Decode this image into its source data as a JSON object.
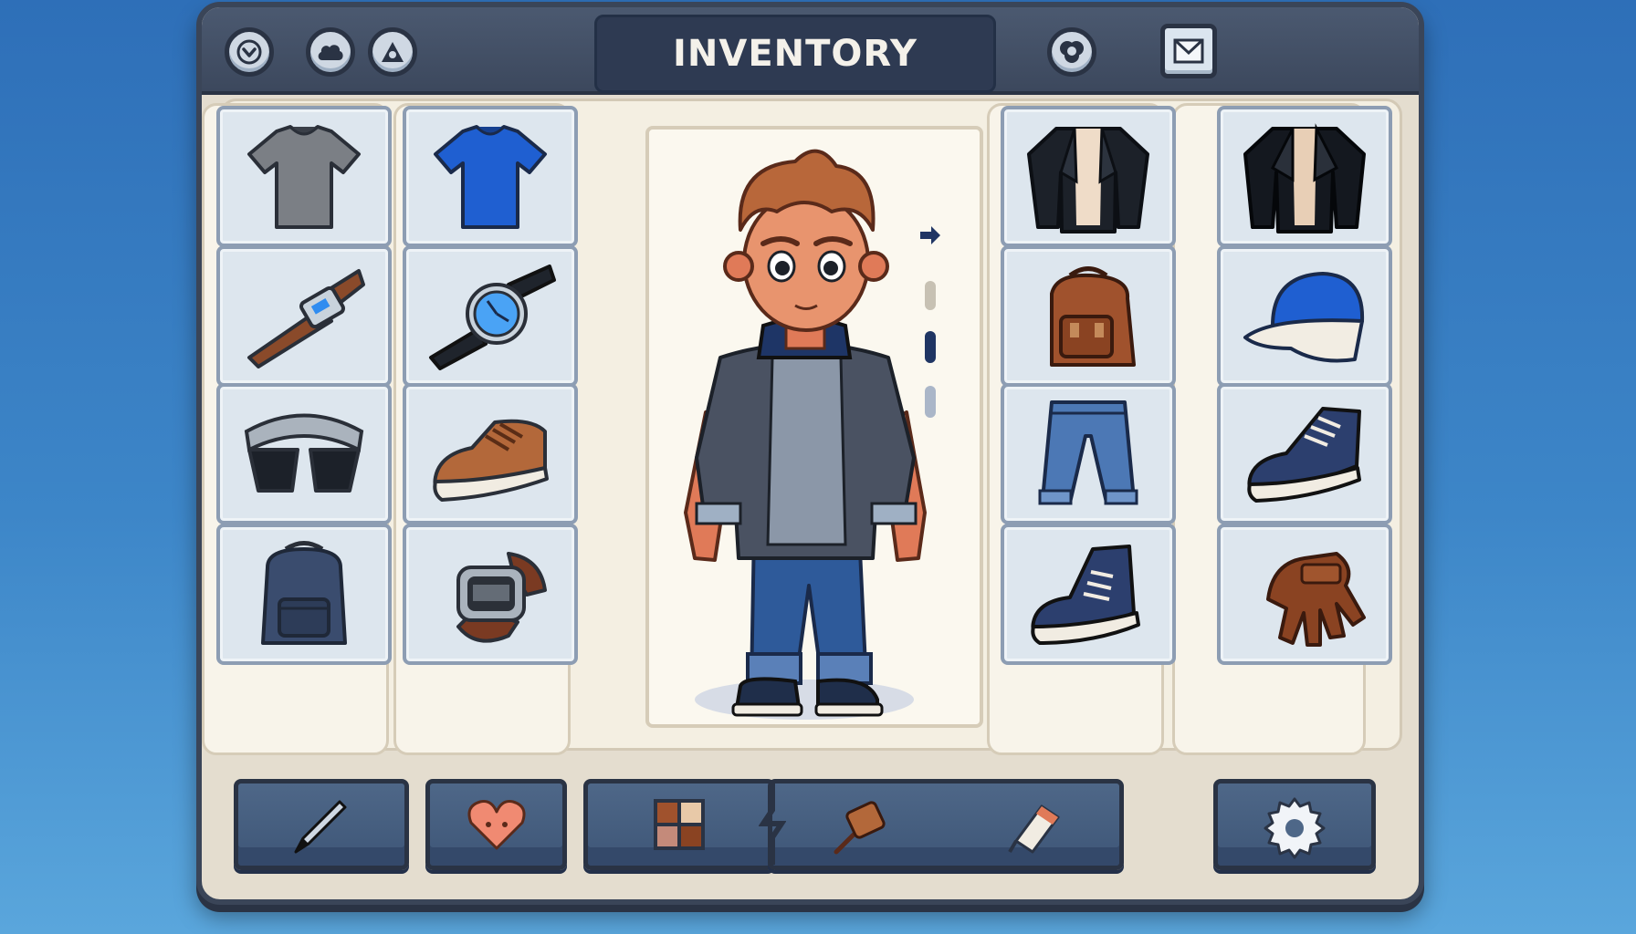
{
  "window": {
    "title": "INVENTORY"
  },
  "topbar": {
    "left_buttons": [
      "checkmark-icon",
      "cloud-icon",
      "triangle-icon"
    ],
    "right_buttons": [
      "cloud-swap-icon",
      "mail-icon"
    ]
  },
  "inventory": {
    "left_column_1": [
      "gray-tshirt",
      "leather-strap-watch",
      "sunglasses",
      "navy-backpack"
    ],
    "left_column_2": [
      "blue-tshirt",
      "blue-dial-watch",
      "brown-sneaker",
      "digital-watch"
    ],
    "right_column_1": [
      "black-leather-jacket",
      "brown-backpack",
      "blue-jeans",
      "navy-high-top-sneaker"
    ],
    "right_column_2": [
      "black-biker-jacket",
      "blue-baseball-cap",
      "navy-sneaker",
      "brown-glove"
    ]
  },
  "character": {
    "equipped": [
      "gray-tshirt",
      "black-leather-jacket",
      "blue-jeans",
      "navy-sneakers"
    ],
    "page_indicator": {
      "total": 3,
      "active": 2
    }
  },
  "toolbar": {
    "buttons": [
      "pen-icon",
      "heart-icon",
      "grid-icon",
      "brush-tools-icon",
      "settings-gear-icon"
    ]
  },
  "colors": {
    "frame": "#3a4558",
    "panel": "#f8f4ea",
    "slot": "#dde6ee",
    "accent_blue": "#1f5fd1"
  }
}
